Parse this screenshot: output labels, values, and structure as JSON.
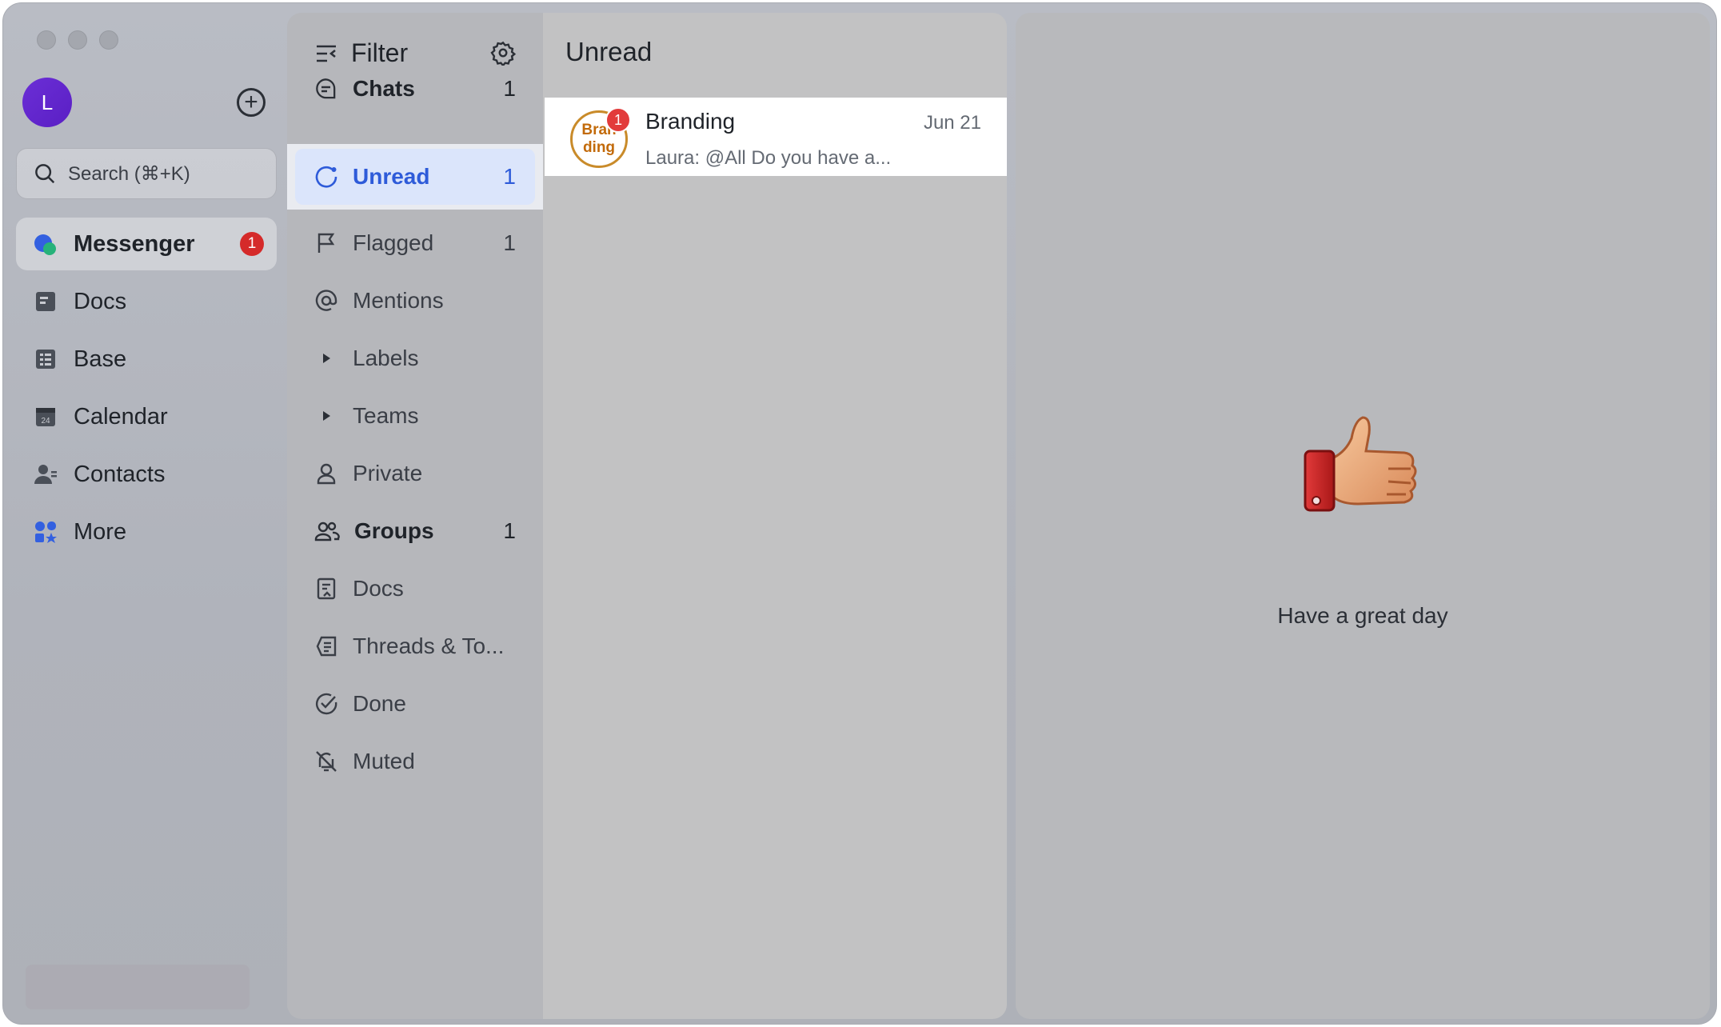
{
  "sidebar": {
    "avatar_initial": "L",
    "search_placeholder": "Search (⌘+K)",
    "items": [
      {
        "label": "Messenger",
        "icon": "messenger-icon",
        "active": true,
        "badge": "1"
      },
      {
        "label": "Docs",
        "icon": "docs-icon"
      },
      {
        "label": "Base",
        "icon": "base-icon"
      },
      {
        "label": "Calendar",
        "icon": "calendar-icon"
      },
      {
        "label": "Contacts",
        "icon": "contacts-icon"
      },
      {
        "label": "More",
        "icon": "more-apps-icon"
      }
    ]
  },
  "filter": {
    "title": "Filter",
    "items": [
      {
        "label": "Chats",
        "count": "1",
        "bold": true
      },
      {
        "label": "Unread",
        "count": "1",
        "selected": true
      },
      {
        "label": "Flagged",
        "count": "1"
      },
      {
        "label": "Mentions"
      },
      {
        "label": "Labels"
      },
      {
        "label": "Teams"
      },
      {
        "label": "Private"
      },
      {
        "label": "Groups",
        "count": "1",
        "bold": true
      },
      {
        "label": "Docs"
      },
      {
        "label": "Threads & To..."
      },
      {
        "label": "Done"
      },
      {
        "label": "Muted"
      }
    ]
  },
  "chat_list": {
    "title": "Unread",
    "chats": [
      {
        "name": "Branding",
        "avatar_line1": "Bran",
        "avatar_line2": "ding",
        "badge": "1",
        "date": "Jun 21",
        "preview": "Laura: @All Do you have a..."
      }
    ]
  },
  "detail": {
    "greeting": "Have a great day"
  },
  "colors": {
    "accent": "#2e5bd9",
    "badge": "#d52a2a",
    "avatar": "#5a1fc4"
  }
}
